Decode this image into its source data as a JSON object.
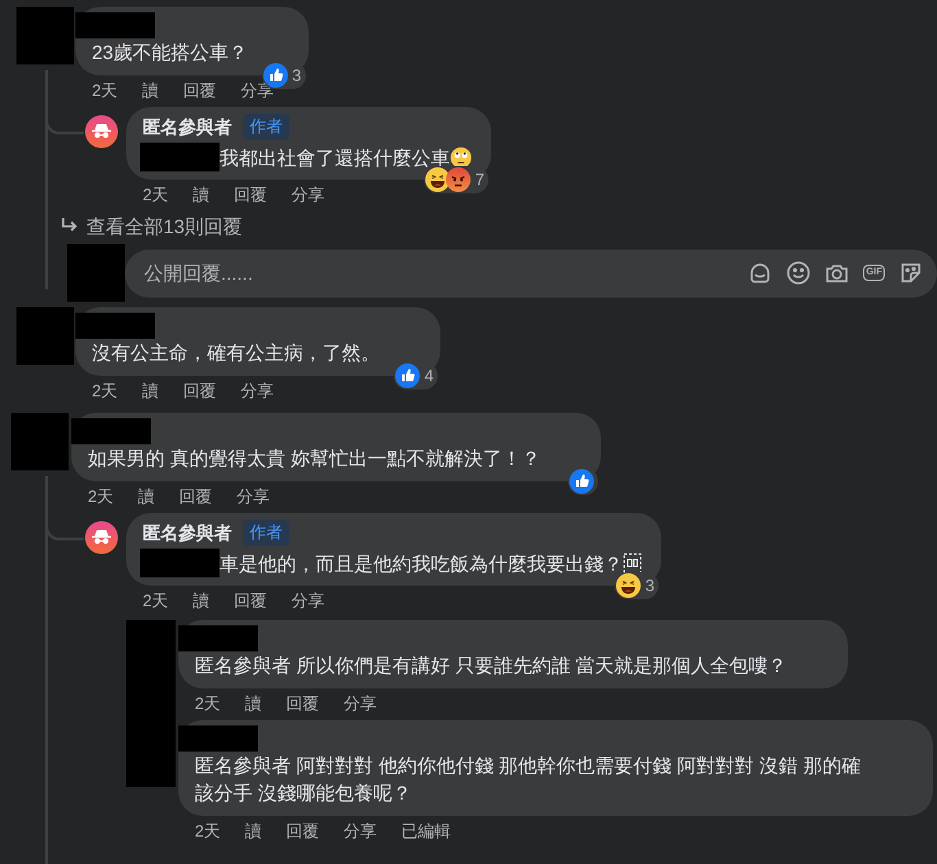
{
  "thread": [
    {
      "avatar": {
        "kind": "redacted"
      },
      "name_redacted": true,
      "text": "23歲不能搭公車？",
      "reactions": [
        {
          "kind": "like"
        }
      ],
      "reaction_count": "3",
      "actions": [
        "2天",
        "讀",
        "回覆",
        "分享"
      ],
      "replies": [
        {
          "avatar": {
            "kind": "anonymous"
          },
          "name": "匿名參與者",
          "badge": "作者",
          "text_prefix_redacted": true,
          "text": "我都出社會了還搭什麼公車",
          "trailing_emoji": {
            "kind": "rolling-eyes"
          },
          "reactions": [
            {
              "kind": "haha"
            },
            {
              "kind": "angry"
            }
          ],
          "reaction_count": "7",
          "actions": [
            "2天",
            "讀",
            "回覆",
            "分享"
          ]
        }
      ],
      "view_more": "查看全部13則回覆",
      "reply_field": {
        "avatar": {
          "kind": "redacted"
        },
        "placeholder": "公開回覆......",
        "tools": [
          {
            "kind": "avatar-sticker"
          },
          {
            "kind": "emoji"
          },
          {
            "kind": "camera"
          },
          {
            "kind": "gif",
            "label": "GIF"
          },
          {
            "kind": "sticker"
          }
        ]
      }
    },
    {
      "avatar": {
        "kind": "redacted"
      },
      "name_redacted": true,
      "text": "沒有公主命，確有公主病，了然。",
      "reactions": [
        {
          "kind": "like"
        }
      ],
      "reaction_count": "4",
      "actions": [
        "2天",
        "讀",
        "回覆",
        "分享"
      ]
    },
    {
      "avatar": {
        "kind": "redacted"
      },
      "name_redacted": true,
      "text": "如果男的 真的覺得太貴 妳幫忙出一點不就解決了！？",
      "reactions": [
        {
          "kind": "like"
        }
      ],
      "actions": [
        "2天",
        "讀",
        "回覆",
        "分享"
      ],
      "replies": [
        {
          "avatar": {
            "kind": "anonymous"
          },
          "name": "匿名參與者",
          "badge": "作者",
          "text_prefix_redacted": true,
          "text": "車是他的，而且是他約我吃飯為什麼我要出錢？",
          "trailing_emoji": {
            "kind": "missing-glyph"
          },
          "reactions": [
            {
              "kind": "haha"
            }
          ],
          "reaction_count": "3",
          "actions": [
            "2天",
            "讀",
            "回覆",
            "分享"
          ],
          "children_avatar": {
            "kind": "redacted"
          },
          "children": [
            {
              "name_redacted": true,
              "text": "匿名參與者 所以你們是有講好 只要誰先約誰 當天就是那個人全包嘍？",
              "actions": [
                "2天",
                "讀",
                "回覆",
                "分享"
              ]
            },
            {
              "name_redacted": true,
              "text": "匿名參與者 阿對對對 他約你他付錢 那他幹你也需要付錢 阿對對對 沒錯 那的確該分手 沒錢哪能包養呢？",
              "actions": [
                "2天",
                "讀",
                "回覆",
                "分享",
                "已編輯"
              ]
            }
          ]
        }
      ]
    }
  ]
}
